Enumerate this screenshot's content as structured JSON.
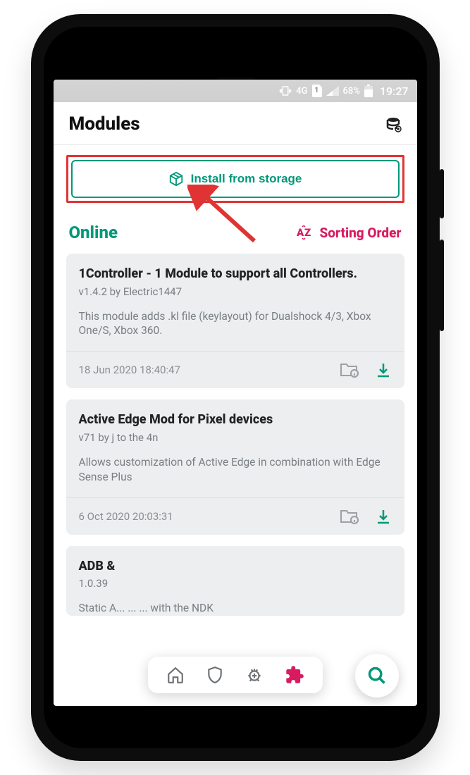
{
  "statusbar": {
    "network": "4G",
    "sim": "1",
    "battery": "68%",
    "time": "19:27"
  },
  "header": {
    "title": "Modules"
  },
  "install_button": {
    "label": "Install from storage"
  },
  "section": {
    "online": "Online",
    "sort": "Sorting Order"
  },
  "modules": [
    {
      "title": "1Controller - 1 Module to support all Controllers.",
      "meta": "v1.4.2 by Electric1447",
      "desc": "This module adds .kl file (keylayout) for Dualshock 4/3, Xbox One/S, Xbox 360.",
      "date": "18 Jun 2020 18:40:47"
    },
    {
      "title": "Active Edge Mod for Pixel devices",
      "meta": "v71 by j to the 4n",
      "desc": "Allows customization of Active Edge in combination with Edge Sense Plus",
      "date": "6 Oct 2020 20:03:31"
    },
    {
      "title": "ADB &",
      "meta": "1.0.39",
      "desc": "Static A... ... ... with the NDK",
      "date": ""
    }
  ],
  "colors": {
    "teal": "#009879",
    "pink": "#d81b60",
    "red": "#e03434"
  }
}
